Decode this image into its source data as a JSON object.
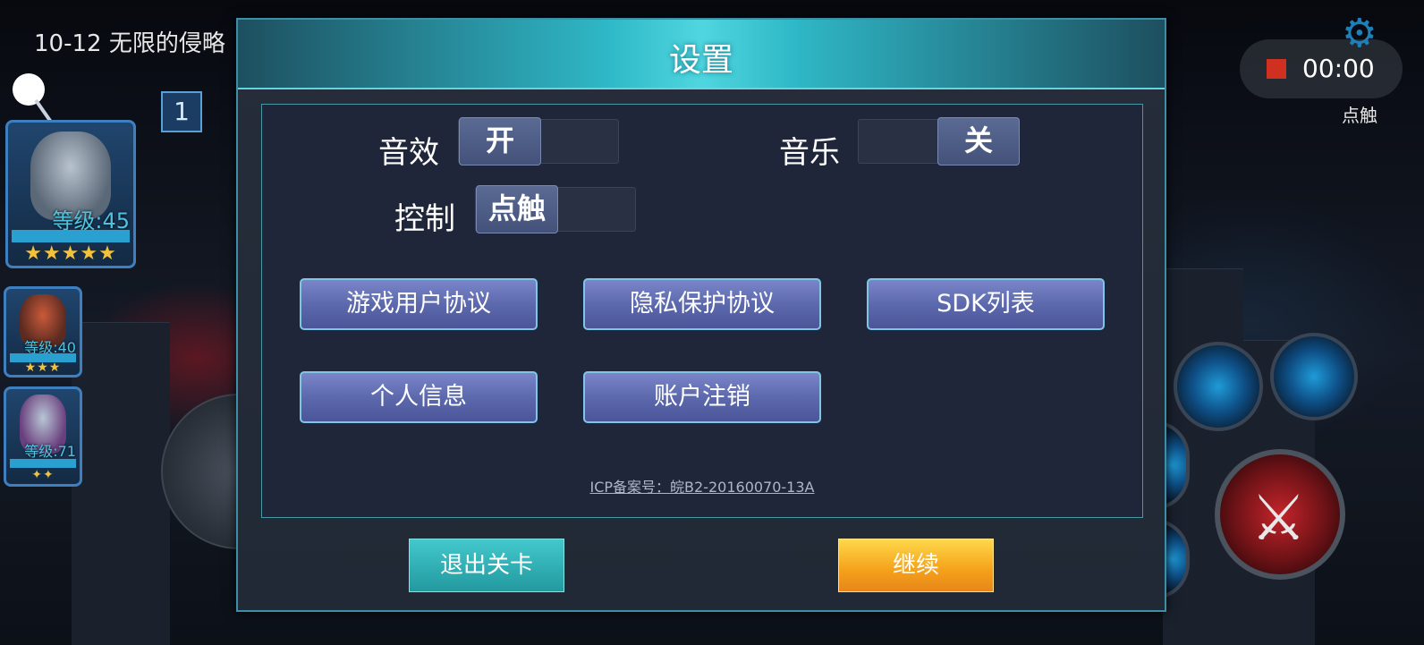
{
  "hud": {
    "level_title": "10-12 无限的侵略",
    "badge_number": "1",
    "record_time": "00:00",
    "touch_label": "点触"
  },
  "heroes": [
    {
      "level": "等级:45",
      "stars": "★★★★★"
    },
    {
      "level": "等级:40",
      "stars": "★★★"
    },
    {
      "level": "等级:71",
      "stars": "✦✦"
    }
  ],
  "settings": {
    "title": "设置",
    "sound_effect": {
      "label": "音效",
      "state": "开"
    },
    "music": {
      "label": "音乐",
      "state": "关"
    },
    "control": {
      "label": "控制",
      "state": "点触"
    },
    "buttons": [
      "游戏用户协议",
      "隐私保护协议",
      "SDK列表",
      "个人信息",
      "账户注销"
    ],
    "icp": "ICP备案号：皖B2-20160070-13A",
    "exit_label": "退出关卡",
    "continue_label": "继续"
  },
  "colors": {
    "header_teal": "#2fb8c7",
    "button_blue": "#5d69ad",
    "continue_orange": "#f4a11a",
    "record_red": "#d0301f"
  }
}
